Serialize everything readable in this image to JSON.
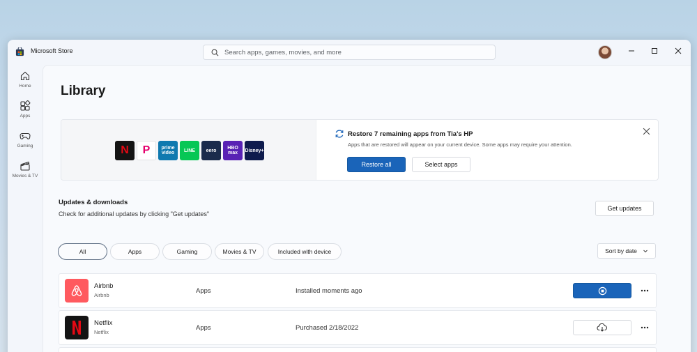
{
  "window": {
    "title": "Microsoft Store",
    "search_placeholder": "Search apps, games, movies, and more"
  },
  "sidebar": {
    "items": [
      {
        "label": "Home",
        "icon": "home-icon"
      },
      {
        "label": "Apps",
        "icon": "apps-icon"
      },
      {
        "label": "Gaming",
        "icon": "gamepad-icon"
      },
      {
        "label": "Movies & TV",
        "icon": "clapperboard-icon"
      }
    ]
  },
  "page": {
    "title": "Library"
  },
  "restore": {
    "title": "Restore 7 remaining apps from Tia's HP",
    "subtitle": "Apps that are restored will appear on your current device. Some apps may require your attention.",
    "restore_all": "Restore all",
    "select_apps": "Select apps",
    "apps": [
      {
        "name": "Netflix",
        "text": "N",
        "bg": "#141414",
        "fg": "#e50914"
      },
      {
        "name": "Pandora",
        "text": "P",
        "bg": "#ffffff",
        "fg": "#e5006d"
      },
      {
        "name": "Prime Video",
        "text": "prime video",
        "bg": "#0f79af",
        "fg": "#ffffff"
      },
      {
        "name": "LINE",
        "text": "LINE",
        "bg": "#06c755",
        "fg": "#ffffff"
      },
      {
        "name": "eero",
        "text": "eero",
        "bg": "#1a2b4c",
        "fg": "#ffffff"
      },
      {
        "name": "HBO Max",
        "text": "HBO max",
        "bg": "#5822b4",
        "fg": "#ffffff"
      },
      {
        "name": "Disney+",
        "text": "Disney+",
        "bg": "#0e1b4d",
        "fg": "#ffffff"
      }
    ]
  },
  "updates": {
    "title": "Updates & downloads",
    "subtitle": "Check for additional updates by clicking \"Get updates\"",
    "button": "Get updates"
  },
  "filters": [
    "All",
    "Apps",
    "Gaming",
    "Movies & TV",
    "Included with device"
  ],
  "sort_label": "Sort by date",
  "library": [
    {
      "name": "Airbnb",
      "publisher": "Airbnb",
      "category": "Apps",
      "status": "Installed moments ago",
      "action": "stop-download"
    },
    {
      "name": "Netflix",
      "publisher": "Netflix",
      "category": "Apps",
      "status": "Purchased 2/18/2022",
      "action": "download"
    }
  ],
  "colors": {
    "accent": "#1a64b9",
    "airbnb": "#ff5a5f",
    "netflix_red": "#e50914"
  }
}
